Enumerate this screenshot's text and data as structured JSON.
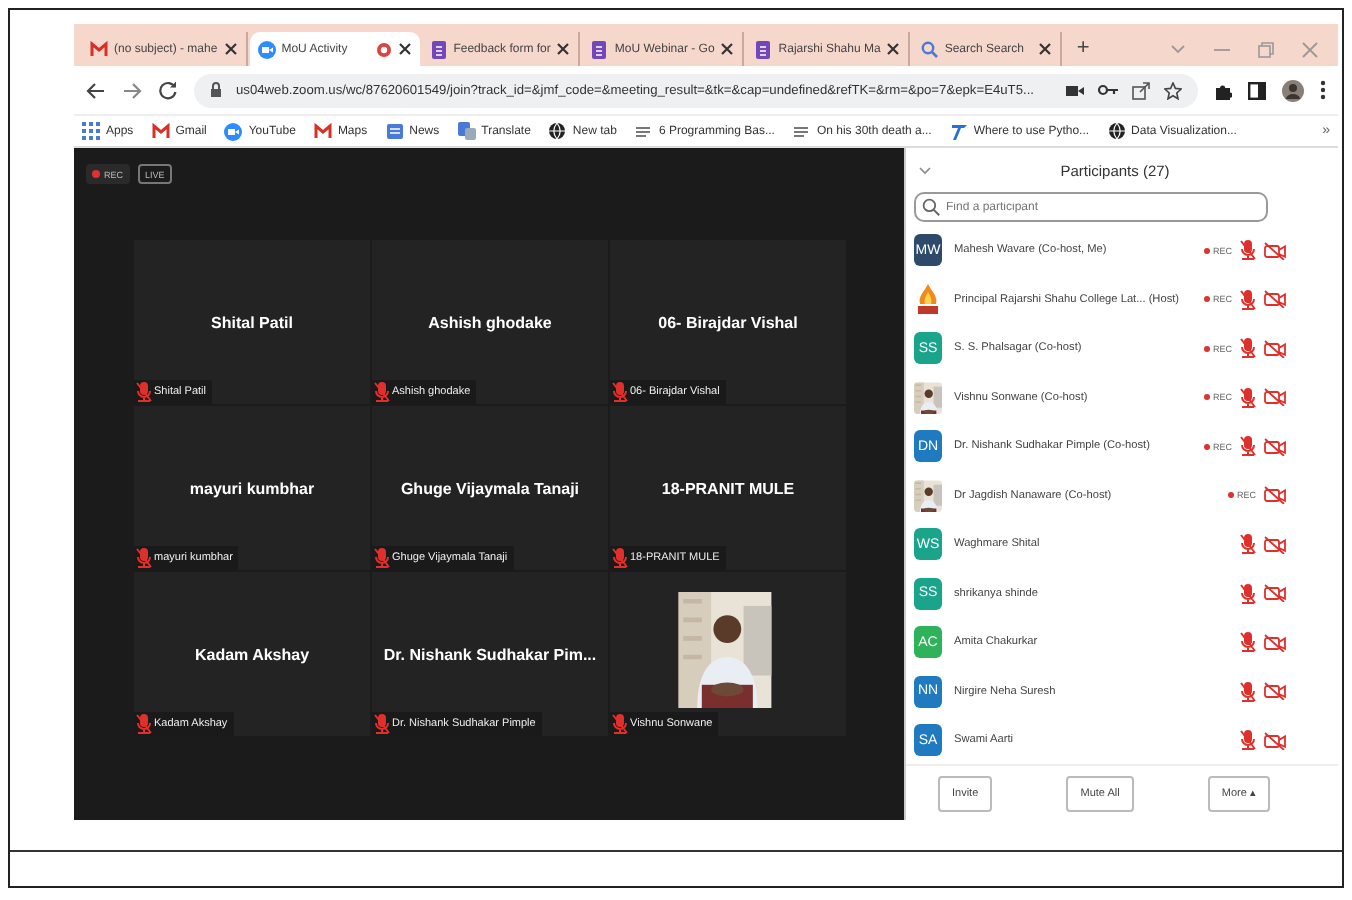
{
  "browser": {
    "tabs": [
      {
        "title": "(no subject) - mahe",
        "kind": "mail",
        "selected": false,
        "recording": false
      },
      {
        "title": "MoU Activity",
        "kind": "video",
        "selected": true,
        "recording": true
      },
      {
        "title": "Feedback form for",
        "kind": "form",
        "selected": false,
        "recording": false
      },
      {
        "title": "MoU Webinar - Go",
        "kind": "form",
        "selected": false,
        "recording": false
      },
      {
        "title": "Rajarshi Shahu Ma",
        "kind": "form",
        "selected": false,
        "recording": false
      },
      {
        "title": "Search Search",
        "kind": "search",
        "selected": false,
        "recording": false
      }
    ],
    "new_tab": "+",
    "url": "us04web.zoom.us/wc/87620601549/join?track_id=&jmf_code=&meeting_result=&tk=&cap=undefined&refTK=&rm=&po=7&epk=E4uT5...",
    "bookmarks": [
      {
        "label": "Apps",
        "kind": "apps"
      },
      {
        "label": "Gmail",
        "kind": "mail"
      },
      {
        "label": "YouTube",
        "kind": "video"
      },
      {
        "label": "Maps",
        "kind": "mail"
      },
      {
        "label": "News",
        "kind": "news"
      },
      {
        "label": "Translate",
        "kind": "translate"
      },
      {
        "label": "New tab",
        "kind": "globe"
      },
      {
        "label": "6 Programming Bas...",
        "kind": "text"
      },
      {
        "label": "On his 30th death a...",
        "kind": "text"
      },
      {
        "label": "Where to use Pytho...",
        "kind": "font"
      },
      {
        "label": "Data Visualization...",
        "kind": "globe"
      }
    ],
    "bookmarks_more": "»"
  },
  "meeting": {
    "badges": [
      "REC",
      "LIVE"
    ],
    "tiles": [
      {
        "kind": "name",
        "title": "Shital Patil",
        "label": "Shital Patil"
      },
      {
        "kind": "name",
        "title": "Ashish ghodake",
        "label": "Ashish ghodake"
      },
      {
        "kind": "name",
        "title": "06- Birajdar Vishal",
        "label": "06- Birajdar Vishal"
      },
      {
        "kind": "name",
        "title": "mayuri kumbhar",
        "label": "mayuri kumbhar"
      },
      {
        "kind": "name",
        "title": "Ghuge Vijaymala Tanaji",
        "label": "Ghuge Vijaymala Tanaji"
      },
      {
        "kind": "name",
        "title": "18-PRANIT MULE",
        "label": "18-PRANIT MULE"
      },
      {
        "kind": "name",
        "title": "Kadam Akshay",
        "label": "Kadam Akshay"
      },
      {
        "kind": "name",
        "title": "Dr. Nishank Sudhakar Pim...",
        "label": "Dr. Nishank Sudhakar Pimple"
      },
      {
        "kind": "video",
        "label": "Vishnu Sonwane"
      }
    ]
  },
  "participants": {
    "title": "Participants (27)",
    "search_placeholder": "Find a participant",
    "items": [
      {
        "kind": "initials",
        "initials": "MW",
        "color": "#2d4a6b",
        "name": "Mahesh Wavare (Co-host, Me)",
        "rec": "REC",
        "mic_muted": true
      },
      {
        "kind": "logo",
        "name": "Principal Rajarshi Shahu College Lat... (Host)",
        "rec": "REC",
        "mic_muted": true
      },
      {
        "kind": "initials",
        "initials": "SS",
        "color": "#1aa58a",
        "name": "S. S. Phalsagar (Co-host)",
        "rec": "REC",
        "mic_muted": true
      },
      {
        "kind": "picture",
        "name": "Vishnu Sonwane (Co-host)",
        "rec": "REC",
        "mic_muted": true
      },
      {
        "kind": "initials",
        "initials": "DN",
        "color": "#1f7ac0",
        "name": "Dr. Nishank Sudhakar Pimple (Co-host)",
        "rec": "REC",
        "mic_muted": true
      },
      {
        "kind": "picture",
        "name": "Dr Jagdish Nanaware (Co-host)",
        "rec": "REC",
        "mic_muted": false
      },
      {
        "kind": "initials",
        "initials": "WS",
        "color": "#1aa58a",
        "name": "Waghmare Shital",
        "mic_muted": true
      },
      {
        "kind": "initials",
        "initials": "SS",
        "color": "#1aa58a",
        "name": "shrikanya shinde",
        "mic_muted": true
      },
      {
        "kind": "initials",
        "initials": "AC",
        "color": "#2fb35a",
        "name": "Amita Chakurkar",
        "mic_muted": true
      },
      {
        "kind": "initials",
        "initials": "NN",
        "color": "#1f7ac0",
        "name": "Nirgire Neha Suresh",
        "mic_muted": true
      },
      {
        "kind": "initials",
        "initials": "SA",
        "color": "#1f7ac0",
        "name": "Swami Aarti",
        "mic_muted": true
      }
    ],
    "buttons": [
      "Invite",
      "Mute All",
      "More ▴"
    ]
  }
}
